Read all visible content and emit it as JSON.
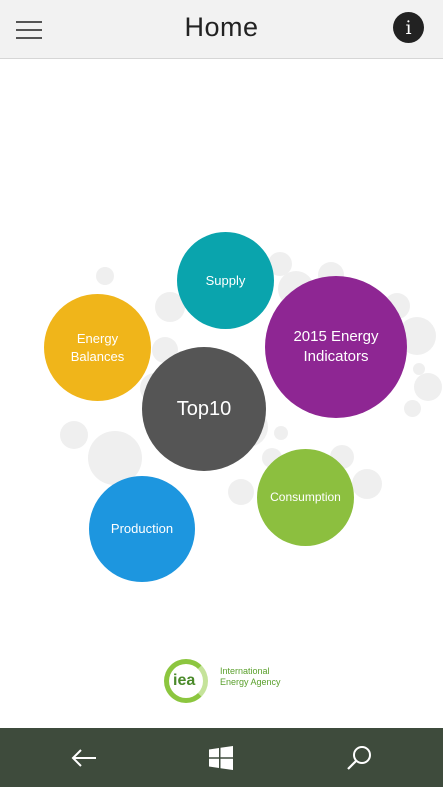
{
  "header": {
    "title": "Home",
    "info_label": "i"
  },
  "bubbles": {
    "supply": "Supply",
    "energy_balances": "Energy\nBalances",
    "indicators": "2015 Energy\nIndicators",
    "top10": "Top10",
    "consumption": "Consumption",
    "production": "Production"
  },
  "colors": {
    "supply": "#0aa4ad",
    "energy_balances": "#f0b51a",
    "indicators": "#8e2693",
    "top10": "#555555",
    "consumption": "#8cbf3f",
    "production": "#1d96df",
    "navbar": "#3e4b3c"
  },
  "logo": {
    "abbr": "iea",
    "name_line1": "International",
    "name_line2": "Energy Agency"
  },
  "navbar": {
    "icons": [
      "back-arrow-icon",
      "windows-start-icon",
      "search-icon"
    ]
  }
}
